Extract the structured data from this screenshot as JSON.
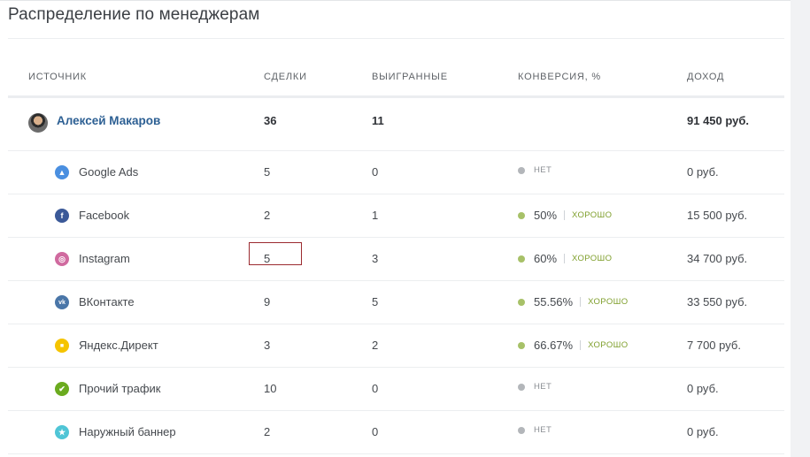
{
  "title": "Распределение по менеджерам",
  "columns": {
    "source": "ИСТОЧНИК",
    "deals": "СДЕЛКИ",
    "won": "ВЫИГРАННЫЕ",
    "conversion": "КОНВЕРСИЯ, %",
    "income": "ДОХОД"
  },
  "manager": {
    "name": "Алексей Макаров",
    "deals": "36",
    "won": "11",
    "income": "91 450 руб."
  },
  "rows": [
    {
      "source": "Google Ads",
      "icon": "google-ads-icon",
      "icon_color": "#4a8fe0",
      "deals": "5",
      "won": "0",
      "conv": "",
      "status": "НЕТ",
      "status_type": "gray",
      "income": "0 руб."
    },
    {
      "source": "Facebook",
      "icon": "facebook-icon",
      "icon_color": "#3b5998",
      "deals": "2",
      "won": "1",
      "conv": "50%",
      "status": "ХОРОШО",
      "status_type": "green",
      "income": "15 500 руб."
    },
    {
      "source": "Instagram",
      "icon": "instagram-icon",
      "icon_color": "#d06a9f",
      "deals": "5",
      "won": "3",
      "conv": "60%",
      "status": "ХОРОШО",
      "status_type": "green",
      "income": "34 700 руб."
    },
    {
      "source": "ВКонтакте",
      "icon": "vk-icon",
      "icon_color": "#4a76a8",
      "deals": "9",
      "won": "5",
      "conv": "55.56%",
      "status": "ХОРОШО",
      "status_type": "green",
      "income": "33 550 руб."
    },
    {
      "source": "Яндекс.Директ",
      "icon": "yandex-direct-icon",
      "icon_color": "#f5c400",
      "deals": "3",
      "won": "2",
      "conv": "66.67%",
      "status": "ХОРОШО",
      "status_type": "green",
      "income": "7 700 руб."
    },
    {
      "source": "Прочий трафик",
      "icon": "other-traffic-icon",
      "icon_color": "#6bab1f",
      "deals": "10",
      "won": "0",
      "conv": "",
      "status": "НЕТ",
      "status_type": "gray",
      "income": "0 руб."
    },
    {
      "source": "Наружный баннер",
      "icon": "outdoor-banner-icon",
      "icon_color": "#4fc5d6",
      "deals": "2",
      "won": "0",
      "conv": "",
      "status": "НЕТ",
      "status_type": "gray",
      "income": "0 руб."
    }
  ]
}
